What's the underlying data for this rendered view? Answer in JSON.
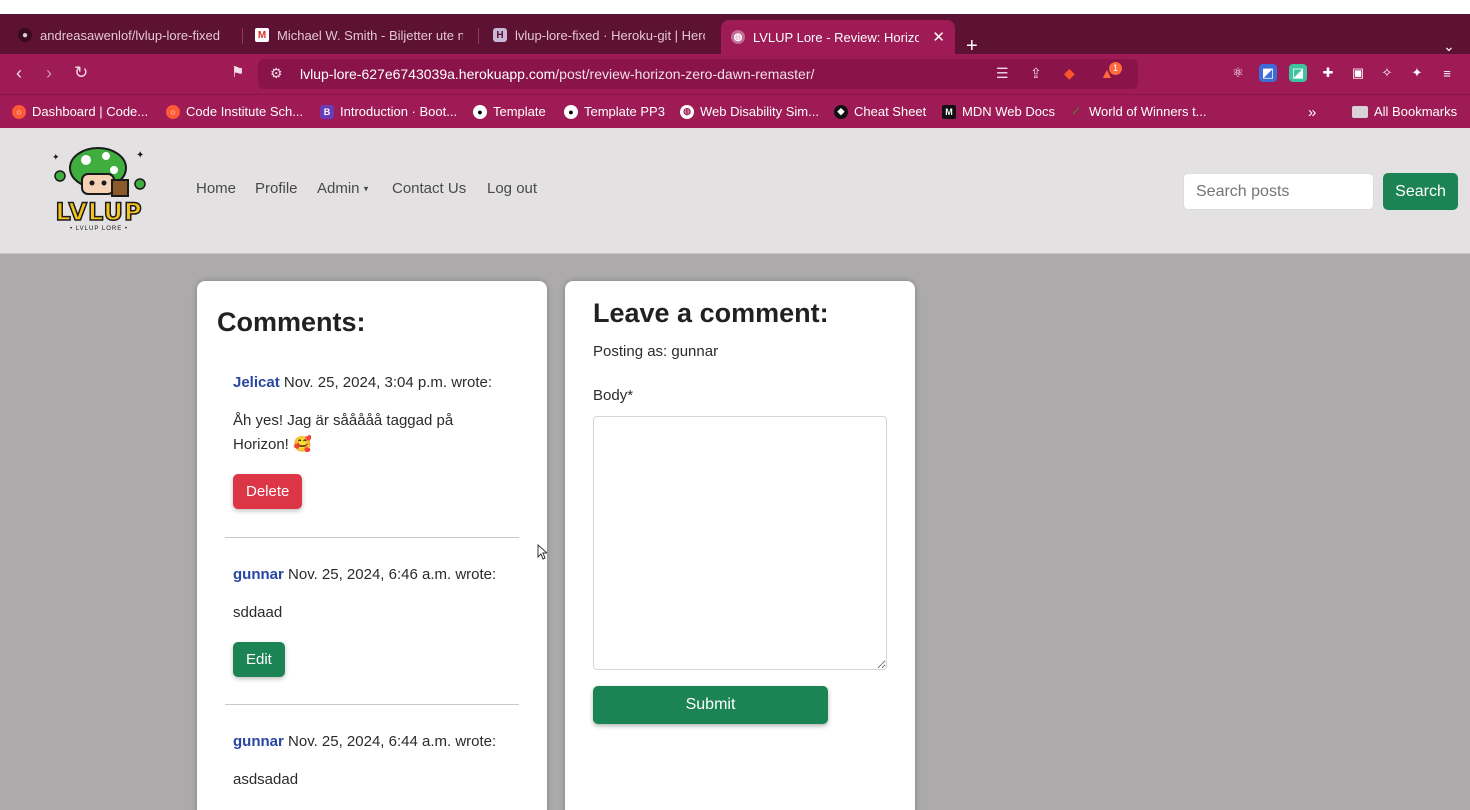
{
  "browser": {
    "tabs": [
      {
        "title": "andreasawenlof/lvlup-lore-fixed",
        "icon": "github-icon"
      },
      {
        "title": "Michael W. Smith - Biljetter ute nu",
        "icon": "gmail-icon"
      },
      {
        "title": "lvlup-lore-fixed · Heroku-git | Heroku",
        "icon": "heroku-icon"
      },
      {
        "title": "LVLUP Lore -  Review: Horizon Zero Dawn",
        "icon": "globe-icon",
        "active": true
      }
    ],
    "url_host": "lvlup-lore-627e6743039a.herokuapp.com",
    "url_path": "/post/review-horizon-zero-dawn-remaster/",
    "brave_badge": "1",
    "bookmarks": [
      {
        "label": "Dashboard | Code...",
        "icon": "code-institute-icon"
      },
      {
        "label": "Code Institute Sch...",
        "icon": "code-institute-icon"
      },
      {
        "label": "Introduction · Boot...",
        "icon": "bootstrap-icon"
      },
      {
        "label": "Template",
        "icon": "github-icon"
      },
      {
        "label": "Template PP3",
        "icon": "github-icon"
      },
      {
        "label": "Web Disability Sim...",
        "icon": "globe-icon"
      },
      {
        "label": "Cheat Sheet",
        "icon": "cheat-sheet-icon"
      },
      {
        "label": "MDN Web Docs",
        "icon": "mdn-icon"
      },
      {
        "label": "World of Winners t...",
        "icon": "leaf-icon"
      }
    ],
    "all_bookmarks": "All Bookmarks"
  },
  "site": {
    "logo_text": "LVLUP",
    "logo_subtext": "• LVLUP LORE •",
    "nav": [
      "Home",
      "Profile",
      "Admin",
      "Contact Us",
      "Log out"
    ],
    "search_placeholder": "Search posts",
    "search_button": "Search"
  },
  "comments": {
    "heading": "Comments:",
    "items": [
      {
        "author": "Jelicat",
        "date": "Nov. 25, 2024, 3:04 p.m.",
        "wrote": "wrote:",
        "body": "Åh yes! Jag är sååååå taggad på Horizon! 🥰",
        "action": "Delete"
      },
      {
        "author": "gunnar",
        "date": "Nov. 25, 2024, 6:46 a.m.",
        "wrote": "wrote:",
        "body": "sddaad",
        "action": "Edit"
      },
      {
        "author": "gunnar",
        "date": "Nov. 25, 2024, 6:44 a.m.",
        "wrote": "wrote:",
        "body": "asdsadad"
      }
    ]
  },
  "form": {
    "heading": "Leave a comment:",
    "posting_as": "Posting as: gunnar",
    "body_label": "Body*",
    "submit": "Submit"
  },
  "colors": {
    "tabbar": "#5d1133",
    "toolbar": "#9e1b55",
    "accent_green": "#1c8454",
    "danger_red": "#dc3545",
    "author_blue": "#2747a3"
  }
}
